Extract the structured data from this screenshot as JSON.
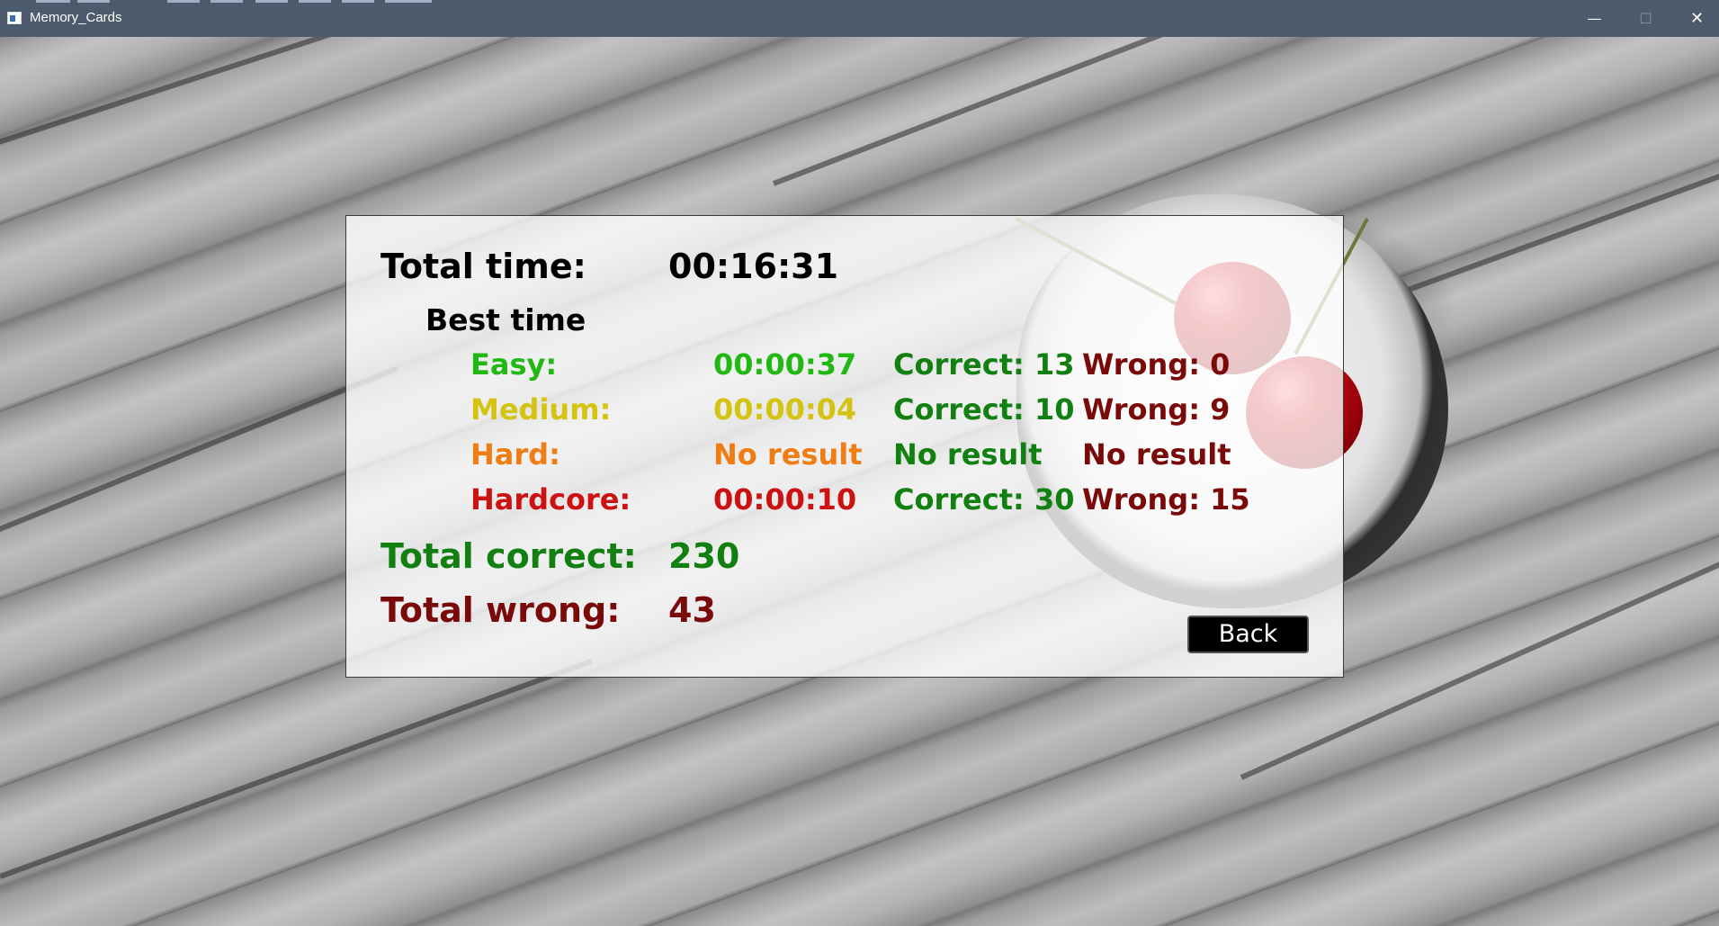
{
  "window": {
    "title": "Memory_Cards",
    "controls": {
      "minimize": "—",
      "maximize": "☐",
      "close": "✕"
    }
  },
  "stats": {
    "total_time_label": "Total time:",
    "total_time_value": "00:16:31",
    "best_time_heading": "Best time",
    "levels": [
      {
        "name": "Easy:",
        "time": "00:00:37",
        "correct": "Correct: 13",
        "wrong": "Wrong: 0",
        "color": "#22b814"
      },
      {
        "name": "Medium:",
        "time": "00:00:04",
        "correct": "Correct: 10",
        "wrong": "Wrong: 9",
        "color": "#d4c411"
      },
      {
        "name": "Hard:",
        "time": "No result",
        "correct": "No result",
        "wrong": "No result",
        "color": "#f07d14"
      },
      {
        "name": "Hardcore:",
        "time": "00:00:10",
        "correct": "Correct: 30",
        "wrong": "Wrong: 15",
        "color": "#cc1111"
      }
    ],
    "correct_color": "#118011",
    "wrong_color": "#7a0a0a",
    "total_correct_label": "Total correct:",
    "total_correct_value": "230",
    "total_wrong_label": "Total wrong:",
    "total_wrong_value": "43"
  },
  "back_button": {
    "label": "Back"
  }
}
